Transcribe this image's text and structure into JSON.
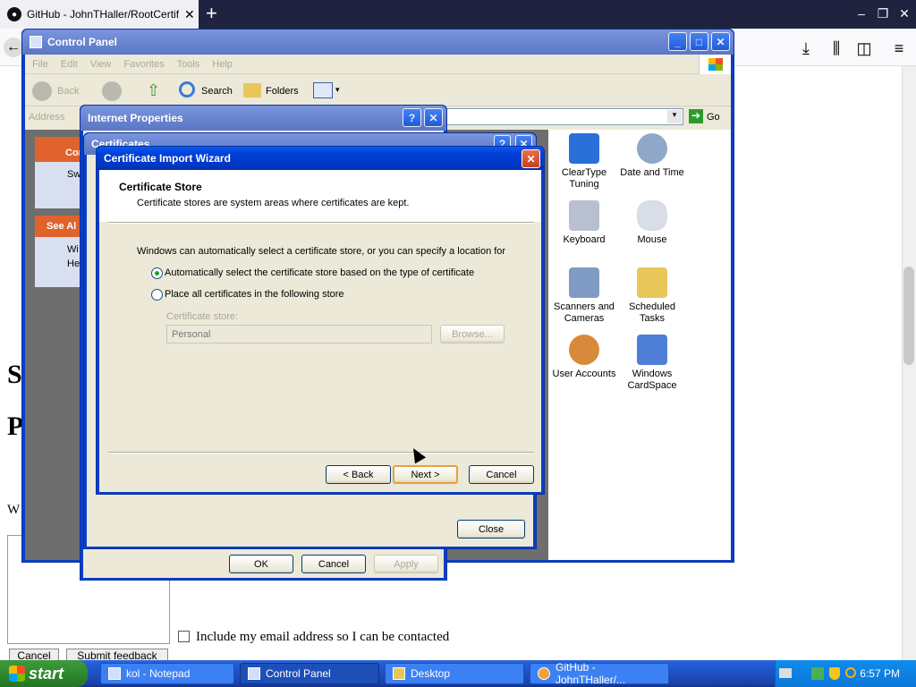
{
  "browser": {
    "tab_title": "GitHub - JohnTHaller/RootCertifica",
    "tab_close": "✕",
    "new_tab": "+",
    "win_min": "–",
    "win_restore": "❐",
    "win_close": "✕"
  },
  "webpage": {
    "letter_s": "S",
    "letter_p": "P",
    "letter_w": "W",
    "checkbox_label": "Include my email address so I can be contacted",
    "cancel_button": "Cancel",
    "submit_button": "Submit feedback"
  },
  "control_panel": {
    "title": "Control Panel",
    "menu": [
      "File",
      "Edit",
      "View",
      "Favorites",
      "Tools",
      "Help"
    ],
    "toolbar": {
      "back": "Back",
      "search": "Search",
      "folders": "Folders"
    },
    "address_label": "Address",
    "go_label": "Go",
    "sidebar_header_1": "Con",
    "sidebar_item_1": "Sw",
    "sidebar_header_2": "See Al",
    "sidebar_item_2": "Wi",
    "sidebar_item_3": "He",
    "icons": [
      {
        "label": "ClearType Tuning",
        "color": "#2a6fd8"
      },
      {
        "label": "Date and Time",
        "color": "#8fa7c8"
      },
      {
        "label": "Keyboard",
        "color": "#b8c0d0"
      },
      {
        "label": "Mouse",
        "color": "#d8dde6"
      },
      {
        "label": "Scanners and Cameras",
        "color": "#7f9bc4"
      },
      {
        "label": "Scheduled Tasks",
        "color": "#e8c65a"
      },
      {
        "label": "User Accounts",
        "color": "#d88a3a"
      },
      {
        "label": "Windows CardSpace",
        "color": "#4f7ed6"
      }
    ]
  },
  "internet_properties": {
    "title": "Internet Properties",
    "help": "?",
    "close": "✕",
    "ok": "OK",
    "cancel": "Cancel",
    "apply": "Apply"
  },
  "certificates": {
    "title": "Certificates",
    "close_button": "Close"
  },
  "wizard": {
    "title": "Certificate Import Wizard",
    "heading": "Certificate Store",
    "subheading": "Certificate stores are system areas where certificates are kept.",
    "intro": "Windows can automatically select a certificate store, or you can specify a location for",
    "option_auto": "Automatically select the certificate store based on the type of certificate",
    "option_manual": "Place all certificates in the following store",
    "store_label": "Certificate store:",
    "store_value": "Personal",
    "browse": "Browse...",
    "back": "< Back",
    "next": "Next >",
    "cancel": "Cancel"
  },
  "taskbar": {
    "start": "start",
    "tasks": [
      "kol - Notepad",
      "Control Panel",
      "Desktop",
      "GitHub - JohnTHaller/..."
    ],
    "clock": "6:57 PM"
  }
}
